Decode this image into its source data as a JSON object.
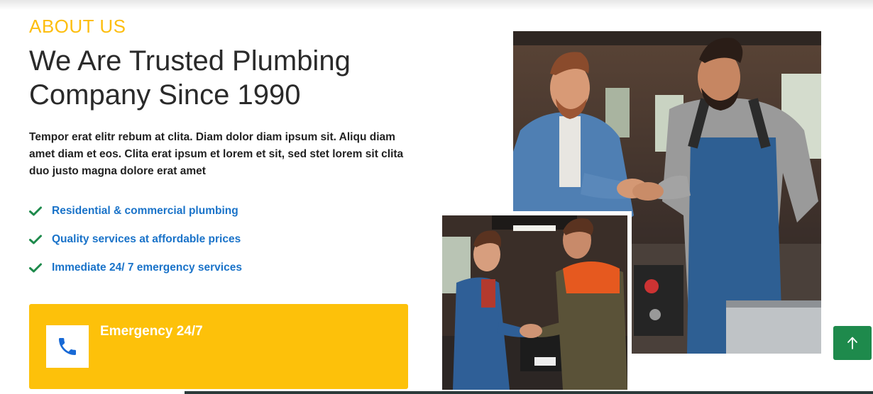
{
  "about": {
    "label": "ABOUT US",
    "title_line1": "We Are Trusted Plumbing",
    "title_line2": "Company Since 1990",
    "description": "Tempor erat elitr rebum at clita. Diam dolor diam ipsum sit. Aliqu diam amet diam et eos. Clita erat ipsum et lorem et sit, sed stet lorem sit clita duo justo magna dolore erat amet"
  },
  "features": [
    {
      "icon": "check-icon",
      "label": "Residential & commercial plumbing"
    },
    {
      "icon": "check-icon",
      "label": "Quality services at affordable prices"
    },
    {
      "icon": "check-icon",
      "label": "Immediate 24/ 7 emergency services"
    }
  ],
  "emergency": {
    "icon": "phone-icon",
    "title": "Emergency 24/7"
  },
  "images": {
    "large": "photo-two-mechanics-handshake-garage",
    "small": "photo-two-workers-handshake-workshop"
  },
  "back_to_top": {
    "icon": "arrow-up-icon"
  },
  "colors": {
    "accent": "#fdbe0f",
    "heading": "#2a2a2a",
    "link": "#1a73c9",
    "check": "#1e8a4c",
    "emergency_bg": "#fdc10a",
    "back_to_top_bg": "#1e8a4c"
  }
}
